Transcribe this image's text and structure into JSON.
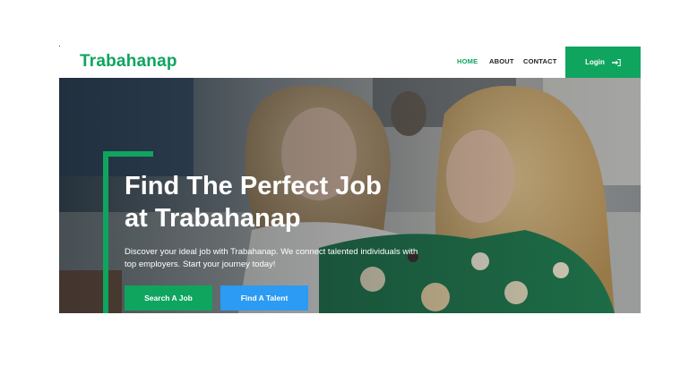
{
  "nav": {
    "brand": "Trabahanap",
    "links": [
      {
        "label": "HOME"
      },
      {
        "label": "ABOUT"
      },
      {
        "label": "CONTACT"
      }
    ],
    "login_label": "Login",
    "login_icon": "sign-in-icon"
  },
  "hero": {
    "headline_line1": "Find The Perfect Job",
    "headline_line2": "at Trabahanap",
    "subtext_line1": "Discover your ideal job with Trabahanap. We connect talented individuals with",
    "subtext_line2": "top employers. Start your journey today!",
    "search_button": "Search A Job",
    "talent_button": "Find A Talent"
  },
  "colors": {
    "brand_green": "#0fa55f",
    "talent_blue": "#2b9bf4"
  }
}
